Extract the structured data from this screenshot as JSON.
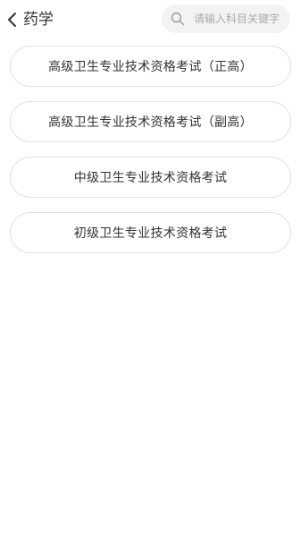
{
  "header": {
    "title": "药学",
    "back_icon": "chevron-left-icon"
  },
  "search": {
    "placeholder": "请输入科目关键字",
    "value": "",
    "icon": "search-icon"
  },
  "exam_list": [
    {
      "label": "高级卫生专业技术资格考试（正高）"
    },
    {
      "label": "高级卫生专业技术资格考试（副高）"
    },
    {
      "label": "中级卫生专业技术资格考试"
    },
    {
      "label": "初级卫生专业技术资格考试"
    }
  ],
  "colors": {
    "text": "#333333",
    "border": "#e2e2e2",
    "search_bg": "#f3f3f3",
    "placeholder": "#aaaaaa"
  }
}
